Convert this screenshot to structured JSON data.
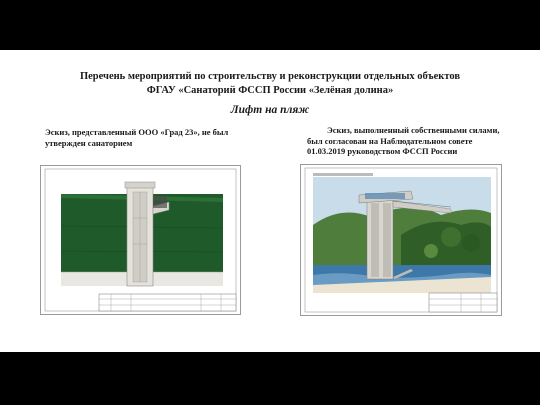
{
  "header": {
    "title_line1": "Перечень мероприятий по строительству и реконструкции отдельных объектов",
    "title_line2": "ФГАУ «Санаторий ФССП России «Зелёная долина»",
    "subtitle": "Лифт на пляж"
  },
  "left_panel": {
    "caption_line1": "Эскиз, представленный ООО «Град 23», не был",
    "caption_line2": "утвержден санаторием"
  },
  "right_panel": {
    "caption_line1": "Эскиз, выполненный собственными силами,",
    "caption_line2": "был согласован на Наблюдательном совете",
    "caption_line3": "01.03.2019 руководством ФССП России"
  },
  "colors": {
    "band": "#000000",
    "foliage": "#1f5a2a",
    "sky": "#c9dcea",
    "sea": "#3d78a8",
    "tower": "#d8d6cf"
  }
}
